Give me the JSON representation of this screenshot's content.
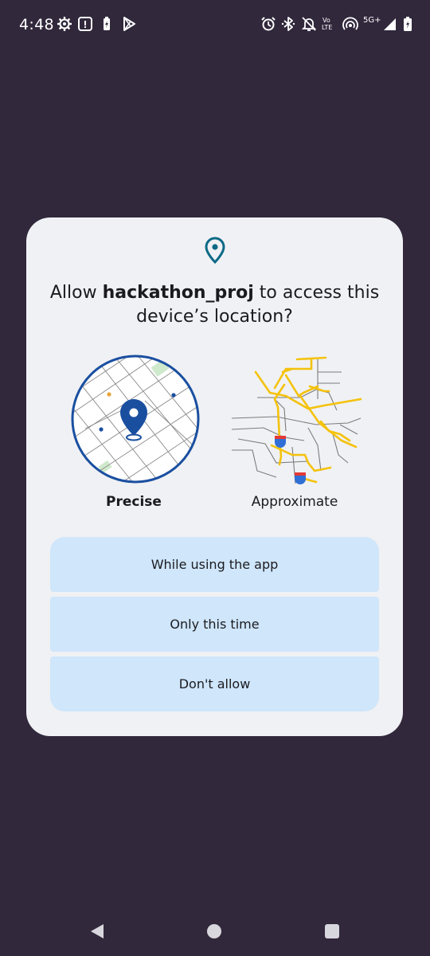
{
  "status_bar": {
    "time": "4:48",
    "left_icons": [
      "settings-gear-icon",
      "notification-box-icon",
      "battery-saver-icon",
      "play-store-icon"
    ],
    "right_icons": [
      "alarm-icon",
      "bluetooth-icon",
      "do-not-disturb-icon",
      "hotspot-icon",
      "signal-icon",
      "battery-icon"
    ],
    "volte_top": "Vo",
    "volte_bottom": "LTE",
    "network": "5G+"
  },
  "dialog": {
    "icon": "location-pin-icon",
    "title_prefix": "Allow ",
    "app_name": "hackathon_proj",
    "title_suffix": " to access this device’s location?",
    "options": {
      "precise_label": "Precise",
      "approximate_label": "Approximate",
      "selected": "Precise"
    },
    "buttons": {
      "while_using": "While using the app",
      "only_this_time": "Only this time",
      "dont_allow": "Don't allow"
    },
    "colors": {
      "accent": "#1a4fa0",
      "button_bg": "#cfe6fb",
      "dialog_bg": "#f0f1f4",
      "scrim": "#31283c",
      "road_yellow": "#f4c20d"
    }
  },
  "nav_bar": {
    "back": "back-icon",
    "home": "home-icon",
    "recents": "recents-icon"
  }
}
